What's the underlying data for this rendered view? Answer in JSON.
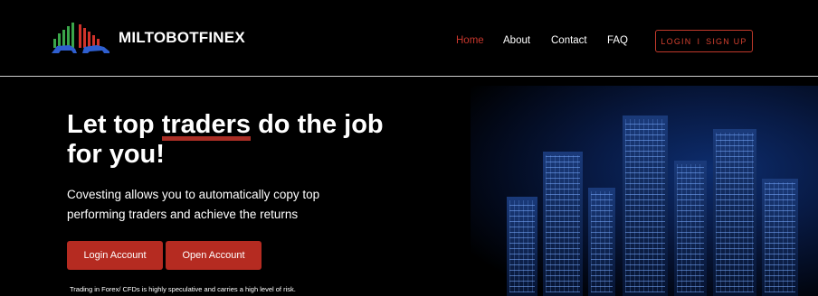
{
  "brand": {
    "name": "MILTOBOTFINEX"
  },
  "nav": {
    "items": [
      {
        "label": "Home",
        "active": true
      },
      {
        "label": "About",
        "active": false
      },
      {
        "label": "Contact",
        "active": false
      },
      {
        "label": "FAQ",
        "active": false
      }
    ],
    "auth": {
      "login": "LOGIN",
      "separator": "I",
      "signup": "SIGN UP"
    }
  },
  "hero": {
    "title_before": "Let top ",
    "title_highlight": "traders",
    "title_after": " do the job for you!",
    "subtitle": "Covesting allows you to automatically copy top performing traders and achieve the returns",
    "buttons": {
      "login": "Login Account",
      "open": "Open Account"
    },
    "risk_note": "Trading in Forex/ CFDs is highly speculative and carries a high level of risk."
  },
  "colors": {
    "accent": "#c7362c",
    "button": "#b52b21",
    "background": "#000000"
  }
}
